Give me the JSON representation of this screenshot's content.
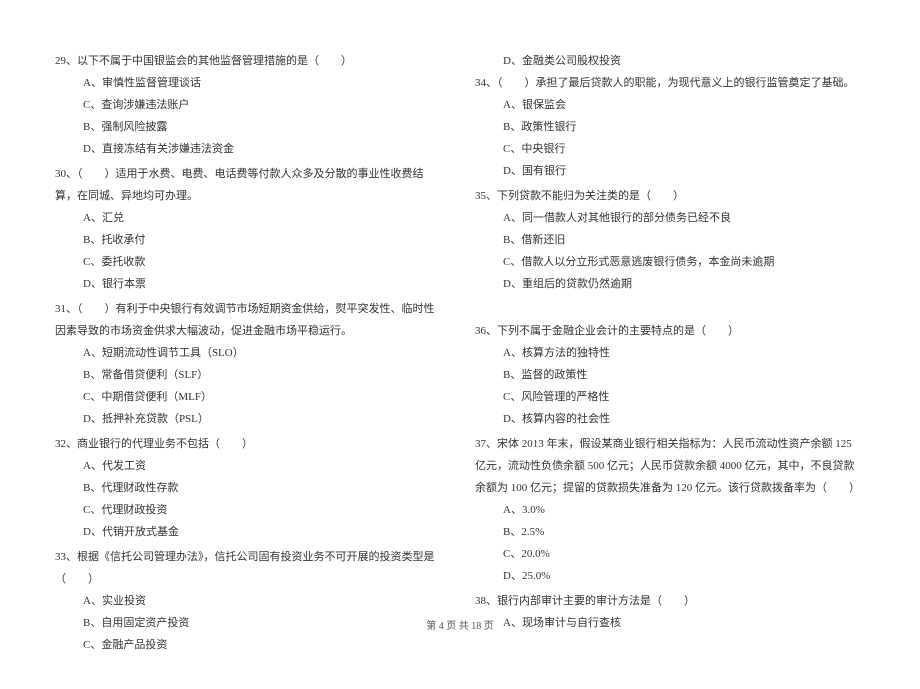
{
  "left": {
    "q29": {
      "stem": "29、以下不属于中国银监会的其他监督管理措施的是（　　）",
      "A": "A、审慎性监督管理谈话",
      "C": "C、查询涉嫌违法账户",
      "B": "B、强制风险披露",
      "D": "D、直接冻结有关涉嫌违法资金"
    },
    "q30": {
      "stem": "30、（　　）适用于水费、电费、电话费等付款人众多及分散的事业性收费结算，在同城、异地均可办理。",
      "A": "A、汇兑",
      "B": "B、托收承付",
      "C": "C、委托收款",
      "D": "D、银行本票"
    },
    "q31": {
      "stem": "31、（　　）有利于中央银行有效调节市场短期资金供给，熨平突发性、临时性因素导致的市场资金供求大幅波动，促进金融市场平稳运行。",
      "A": "A、短期流动性调节工具（SLO）",
      "B": "B、常备借贷便利（SLF）",
      "C": "C、中期借贷便利（MLF）",
      "D": "D、抵押补充贷款（PSL）"
    },
    "q32": {
      "stem": "32、商业银行的代理业务不包括（　　）",
      "A": "A、代发工资",
      "B": "B、代理财政性存款",
      "C": "C、代理财政投资",
      "D": "D、代销开放式基金"
    },
    "q33": {
      "stem": "33、根据《信托公司管理办法》，信托公司固有投资业务不可开展的投资类型是（　　）",
      "A": "A、实业投资",
      "B": "B、自用固定资产投资",
      "C": "C、金融产品投资"
    }
  },
  "right": {
    "q33d": "D、金融类公司股权投资",
    "q34": {
      "stem": "34、（　　）承担了最后贷款人的职能，为现代意义上的银行监管奠定了基础。",
      "A": "A、银保监会",
      "B": "B、政策性银行",
      "C": "C、中央银行",
      "D": "D、国有银行"
    },
    "q35": {
      "stem": "35、下列贷款不能归为关注类的是（　　）",
      "A": "A、同一借款人对其他银行的部分债务已经不良",
      "B": "B、借新还旧",
      "C": "C、借款人以分立形式恶意逃废银行债务，本金尚未逾期",
      "D": "D、重组后的贷款仍然逾期"
    },
    "q36": {
      "stem": "36、下列不属于金融企业会计的主要特点的是（　　）",
      "A": "A、核算方法的独特性",
      "B": "B、监督的政策性",
      "C": "C、风险管理的严格性",
      "D": "D、核算内容的社会性"
    },
    "q37": {
      "stem": "37、宋体 2013 年末，假设某商业银行相关指标为：人民币流动性资产余额 125 亿元，流动性负债余额 500 亿元；人民币贷款余额 4000 亿元，其中，不良贷款余额为 100 亿元；提留的贷款损失准备为 120 亿元。该行贷款拨备率为（　　）",
      "A": "A、3.0%",
      "B": "B、2.5%",
      "C": "C、20.0%",
      "D": "D、25.0%"
    },
    "q38": {
      "stem": "38、银行内部审计主要的审计方法是（　　）",
      "A": "A、现场审计与自行查核"
    }
  },
  "footer": "第 4 页 共 18 页"
}
